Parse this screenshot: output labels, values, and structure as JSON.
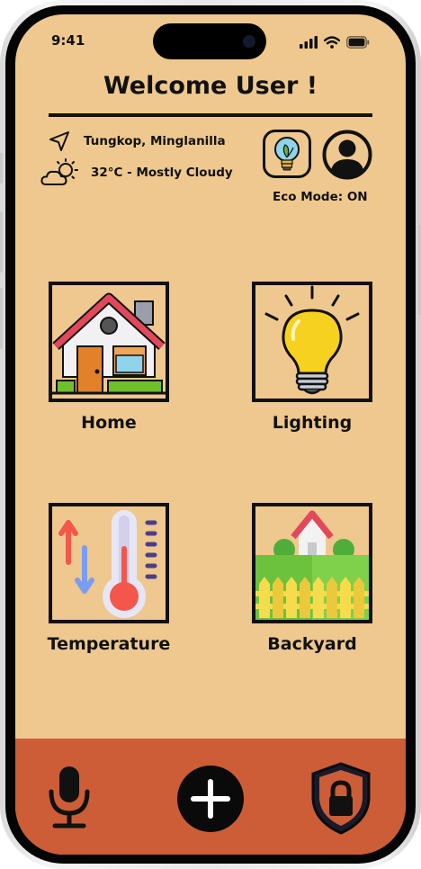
{
  "status_bar": {
    "time": "9:41"
  },
  "header": {
    "title": "Welcome User !"
  },
  "info": {
    "location": "Tungkop, Minglanilla",
    "weather": "32°C - Mostly Cloudy",
    "eco_mode_label": "Eco Mode: ON"
  },
  "tiles": [
    {
      "label": "Home",
      "icon": "house-icon"
    },
    {
      "label": "Lighting",
      "icon": "light-bulb-icon"
    },
    {
      "label": "Temperature",
      "icon": "thermometer-icon"
    },
    {
      "label": "Backyard",
      "icon": "backyard-icon"
    }
  ],
  "bottom_nav": {
    "items": [
      {
        "icon": "microphone-icon"
      },
      {
        "icon": "plus-icon"
      },
      {
        "icon": "shield-lock-icon"
      }
    ]
  },
  "colors": {
    "background": "#eec88f",
    "bottom_bar": "#cc5d37",
    "text": "#111111"
  }
}
